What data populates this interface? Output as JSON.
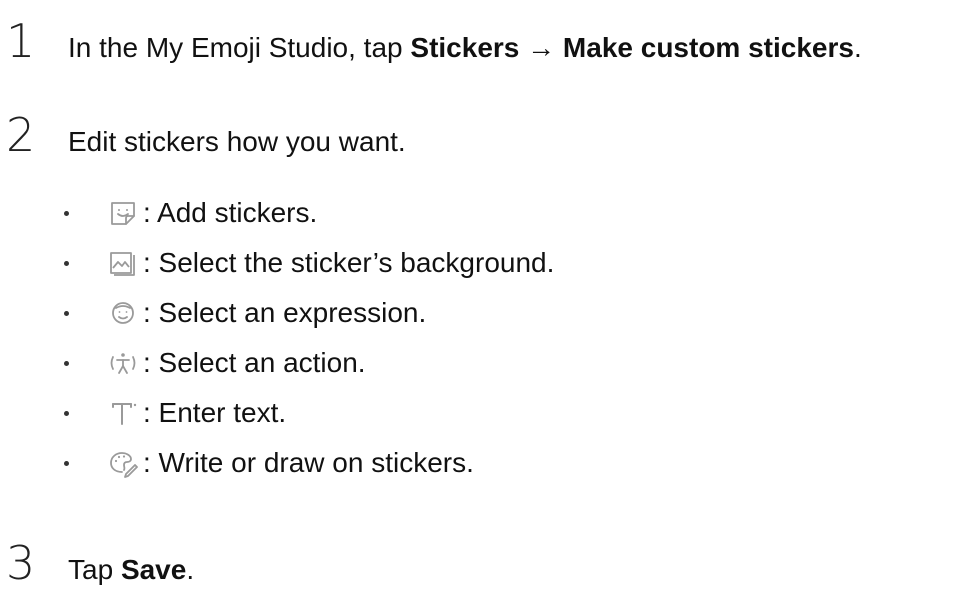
{
  "steps": [
    {
      "number": "1",
      "prefix": "In the My Emoji Studio, tap ",
      "bold1": "Stickers",
      "arrow": " → ",
      "bold2": "Make custom stickers",
      "suffix": "."
    },
    {
      "number": "2",
      "text": "Edit stickers how you want."
    },
    {
      "number": "3",
      "prefix": "Tap ",
      "bold": "Save",
      "suffix": "."
    }
  ],
  "bullets": [
    {
      "icon": "add-sticker-icon",
      "text": ": Add stickers."
    },
    {
      "icon": "background-image-icon",
      "text": ": Select the sticker’s background."
    },
    {
      "icon": "expression-face-icon",
      "text": ": Select an expression."
    },
    {
      "icon": "action-figure-icon",
      "text": ": Select an action."
    },
    {
      "icon": "text-icon",
      "text": ": Enter text."
    },
    {
      "icon": "draw-palette-icon",
      "text": ": Write or draw on stickers."
    }
  ],
  "colors": {
    "text": "#111111",
    "icon": "#9a9a9a"
  }
}
